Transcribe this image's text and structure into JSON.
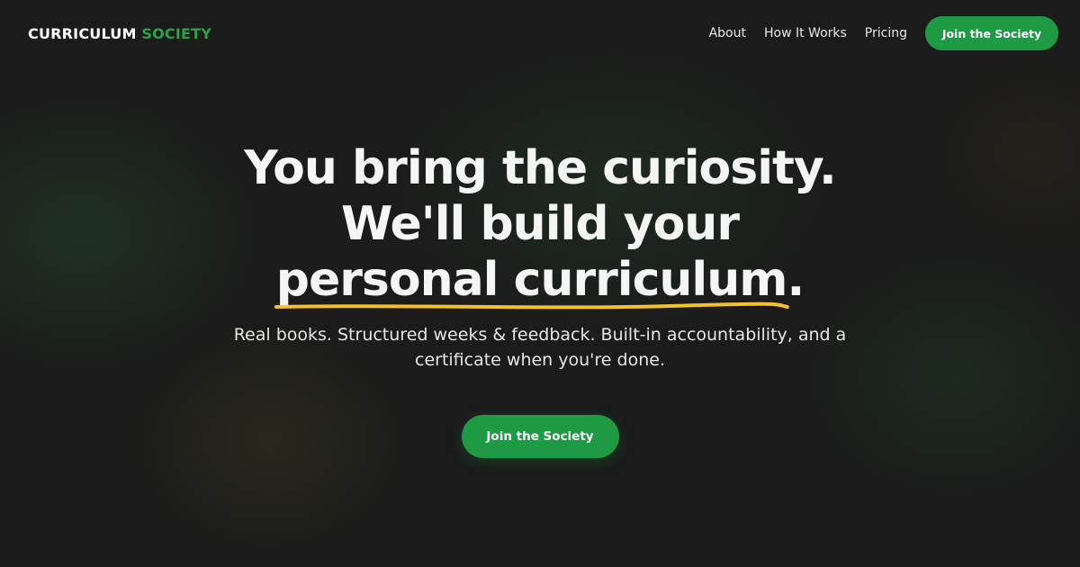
{
  "brand": {
    "part1": "CURRICULUM",
    "part2": "SOCIETY"
  },
  "nav": {
    "links": [
      "About",
      "How It Works",
      "Pricing"
    ],
    "cta_label": "Join the Society"
  },
  "hero": {
    "headline_line1": "You bring the curiosity.",
    "headline_line2": "We'll build your",
    "headline_line3_underlined": "personal curriculum",
    "headline_line3_end": ".",
    "subheadline": "Real books. Structured weeks & feedback. Built-in accountability, and a certificate when you're done.",
    "cta_label": "Join the Society"
  },
  "colors": {
    "background": "#1b1b1b",
    "brand_green": "#1f9a44",
    "underline_yellow": "#f2c12e"
  }
}
